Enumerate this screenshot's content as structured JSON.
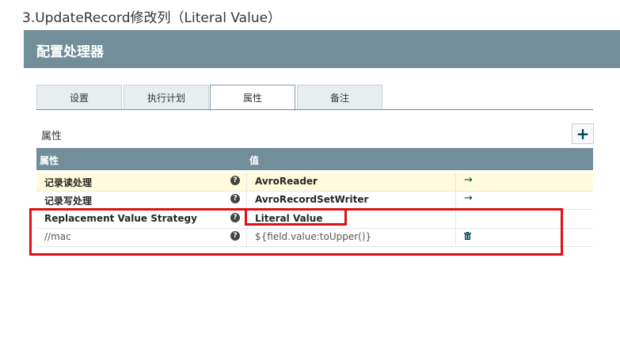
{
  "heading": "3.UpdateRecord修改列（Literal Value）",
  "dialog": {
    "title": "配置处理器"
  },
  "tabs": [
    {
      "label": "设置"
    },
    {
      "label": "执行计划"
    },
    {
      "label": "属性",
      "active": true
    },
    {
      "label": "备注"
    }
  ],
  "properties": {
    "section_label": "属性",
    "add_button": "+",
    "columns": {
      "name": "属性",
      "value": "值"
    },
    "rows": [
      {
        "name": "记录读处理",
        "value": "AvroReader",
        "action": "→"
      },
      {
        "name": "记录写处理",
        "value": "AvroRecordSetWriter",
        "action": "→"
      },
      {
        "name": "Replacement Value Strategy",
        "value": "Literal Value"
      },
      {
        "name": "//mac",
        "value": "${field.value:toUpper()}"
      }
    ]
  },
  "help_glyph": "?",
  "colors": {
    "header": "#728e9b",
    "highlight_row": "#fffadb",
    "annotation": "#dd1111"
  }
}
